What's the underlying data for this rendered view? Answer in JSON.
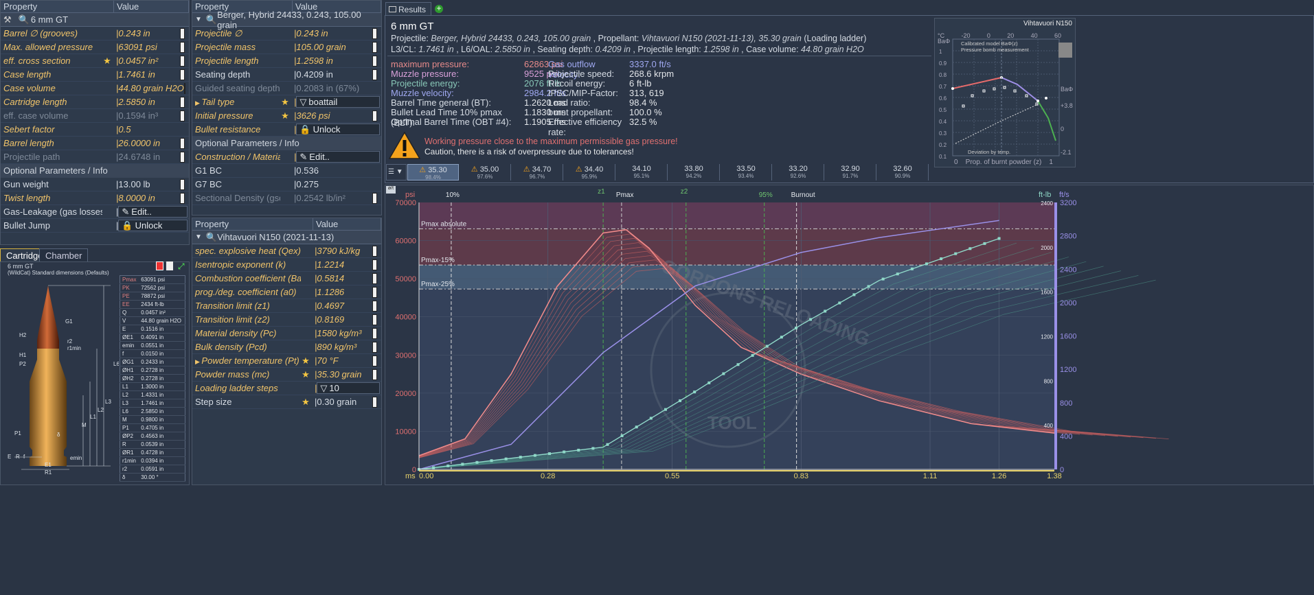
{
  "cartridge_panel": {
    "headers": [
      "Property",
      "Value"
    ],
    "title": "6 mm GT",
    "rows": [
      {
        "k": "Barrel ∅ (grooves)",
        "v": "0.243 in",
        "style": "it",
        "spin": true
      },
      {
        "k": "Max. allowed pressure",
        "v": "63091 psi",
        "style": "it",
        "spin": true
      },
      {
        "k": "eff. cross section",
        "v": "0.0457 in²",
        "style": "it",
        "star": true,
        "spin": true
      },
      {
        "k": "Case length",
        "v": "1.7461 in",
        "style": "it",
        "spin": true
      },
      {
        "k": "Case volume",
        "v": "44.80 grain H2O",
        "style": "it",
        "spin": true
      },
      {
        "k": "Cartridge length",
        "v": "2.5850 in",
        "style": "it",
        "spin": true
      },
      {
        "k": "eff. case volume",
        "v": "0.1594 in³",
        "style": "dim",
        "spin": true
      },
      {
        "k": "Sebert factor",
        "v": "0.5",
        "style": "it"
      },
      {
        "k": "Barrel length",
        "v": "26.0000 in",
        "style": "it",
        "spin": true
      },
      {
        "k": "Projectile path",
        "v": "24.6748 in",
        "style": "dim",
        "spin": true
      }
    ],
    "optional_title": "Optional Parameters / Info",
    "optional_rows": [
      {
        "k": "Gun weight",
        "v": "13.00 lb",
        "style": "",
        "spin": true
      },
      {
        "k": "Twist length",
        "v": "8.0000 in",
        "style": "it",
        "spin": true
      },
      {
        "k": "Gas-Leakage (gas losses)",
        "v": "Edit..",
        "style": "",
        "button": true
      },
      {
        "k": "Bullet Jump",
        "v": "Unlock",
        "style": "",
        "button": true
      }
    ]
  },
  "projectile_panel": {
    "headers": [
      "Property",
      "Value"
    ],
    "title": "Berger, Hybrid 24433, 0.243, 105.00 grain",
    "rows": [
      {
        "k": "Projectile ∅",
        "v": "0.243 in",
        "style": "it",
        "spin": true
      },
      {
        "k": "Projectile mass",
        "v": "105.00 grain",
        "style": "it",
        "spin": true
      },
      {
        "k": "Projectile length",
        "v": "1.2598 in",
        "style": "it",
        "spin": true
      },
      {
        "k": "Seating depth",
        "v": "0.4209 in",
        "style": "",
        "spin": true
      },
      {
        "k": "Guided seating depth",
        "v": "0.2083 in (67%)",
        "style": "dim"
      },
      {
        "k": "Tail type",
        "v": "boattail",
        "style": "it",
        "star": true,
        "button": true,
        "expand": true
      },
      {
        "k": "Initial pressure",
        "v": "3626 psi",
        "style": "it",
        "star": true,
        "spin": true
      },
      {
        "k": "Bullet resistance",
        "v": "Unlock",
        "style": "it",
        "button": true
      }
    ],
    "optional_title": "Optional Parameters / Info",
    "optional_rows": [
      {
        "k": "Construction / Material",
        "v": "Edit..",
        "style": "it",
        "button": true
      },
      {
        "k": "G1 BC",
        "v": "0.536",
        "style": ""
      },
      {
        "k": "G7 BC",
        "v": "0.275",
        "style": ""
      },
      {
        "k": "Sectional Density (gsd)",
        "v": "0.2542 lb/in²",
        "style": "dim",
        "spin": true
      }
    ]
  },
  "powder_panel": {
    "headers": [
      "Property",
      "Value"
    ],
    "title": "Vihtavuori N150 (2021-11-13)",
    "rows": [
      {
        "k": "spec. explosive heat (Qex)",
        "v": "3790 kJ/kg",
        "style": "it",
        "spin": true
      },
      {
        "k": "Isentropic exponent (k)",
        "v": "1.2214",
        "style": "it",
        "spin": true
      },
      {
        "k": "Combustion coefficient (Ba)",
        "v": "0.5814",
        "style": "it",
        "spin": true
      },
      {
        "k": "prog./deg. coefficient (a0)",
        "v": "1.1286",
        "style": "it",
        "spin": true
      },
      {
        "k": "Transition limit (z1)",
        "v": "0.4697",
        "style": "it",
        "spin": true
      },
      {
        "k": "Transition limit (z2)",
        "v": "0.8169",
        "style": "it",
        "spin": true
      },
      {
        "k": "Material density (Pc)",
        "v": "1580 kg/m³",
        "style": "it",
        "spin": true
      },
      {
        "k": "Bulk density (Pcd)",
        "v": "890 kg/m³",
        "style": "it",
        "spin": true
      },
      {
        "k": "Powder temperature (Pt)",
        "v": "70 °F",
        "style": "it",
        "star": true,
        "spin": true,
        "expand": true
      },
      {
        "k": "Powder mass (mc)",
        "v": "35.30 grain",
        "style": "it",
        "star": true,
        "spin": true
      },
      {
        "k": "Loading ladder steps",
        "v": "10",
        "style": "it",
        "button": true
      },
      {
        "k": "Step size",
        "v": "0.30 grain",
        "style": "",
        "star": true,
        "spin": true
      }
    ]
  },
  "lower_tabs": [
    "Cartridge",
    "Chamber"
  ],
  "drawing": {
    "title": "6 mm GT",
    "subtitle": "(WildCat) Standard dimensions (Defaults)",
    "labels": [
      "G1",
      "H2",
      "r2",
      "r1min",
      "H1",
      "P2",
      "L6",
      "L3",
      "L2",
      "L1",
      "M",
      "P1",
      "δ",
      "E",
      "R",
      "f",
      "E1",
      "R1",
      "emin"
    ],
    "specs": [
      [
        "Pmax",
        "63091 psi"
      ],
      [
        "PK",
        "72562 psi"
      ],
      [
        "PE",
        "78872 psi"
      ],
      [
        "EE",
        "2434 ft-lb"
      ],
      [
        "Q",
        "0.0457 in²"
      ],
      [
        "V",
        "44.80 grain H2O"
      ],
      [
        "E",
        "0.1516 in"
      ],
      [
        "ØE1",
        "0.4091 in"
      ],
      [
        "emin",
        "0.0551 in"
      ],
      [
        "f",
        "0.0150 in"
      ],
      [
        "ØG1",
        "0.2433 in"
      ],
      [
        "ØH1",
        "0.2728 in"
      ],
      [
        "ØH2",
        "0.2728 in"
      ],
      [
        "L1",
        "1.3000 in"
      ],
      [
        "L2",
        "1.4331 in"
      ],
      [
        "L3",
        "1.7461 in"
      ],
      [
        "L6",
        "2.5850 in"
      ],
      [
        "M",
        "0.9800 in"
      ],
      [
        "P1",
        "0.4705 in"
      ],
      [
        "ØP2",
        "0.4563 in"
      ],
      [
        "R",
        "0.0539 in"
      ],
      [
        "ØR1",
        "0.4728 in"
      ],
      [
        "r1min",
        "0.0394 in"
      ],
      [
        "r2",
        "0.0591 in"
      ],
      [
        "δ",
        "30.00 °"
      ]
    ]
  },
  "results": {
    "tab_label": "Results",
    "title": "6 mm GT",
    "line1_parts": [
      "Projectile:",
      "Berger, Hybrid 24433, 0.243, 105.00 grain",
      ", Propellant:",
      "Vihtavuori N150 (2021-11-13), 35.30 grain",
      "(Loading ladder)"
    ],
    "line2_parts": [
      "L3/CL:",
      "1.7461 in",
      ", L6/OAL:",
      "2.5850 in",
      ", Seating depth:",
      "0.4209 in",
      ", Projectile length:",
      "1.2598 in",
      ", Case volume:",
      "44.80 grain H2O"
    ],
    "col1": [
      {
        "k": "maximum pressure:",
        "v": "62863 psi",
        "c": "lbl"
      },
      {
        "k": "Muzzle pressure:",
        "v": "9525 psi",
        "c": "lbl2"
      },
      {
        "k": "Projectile energy:",
        "v": "2076 ft-lb",
        "c": "lbl4"
      },
      {
        "k": "Muzzle velocity:",
        "v": "2984.2 ft/s",
        "c": "lbl3"
      },
      {
        "k": "Barrel Time general (BT):",
        "v": "1.2620 ms",
        "c": ""
      },
      {
        "k": "Bullet Lead Time 10% pmax (BLT):",
        "v": "1.1830 ms",
        "c": ""
      },
      {
        "k": "Optimal Barrel Time (OBT #4):",
        "v": "1.1905 ms",
        "c": ""
      }
    ],
    "col2": [
      {
        "k": "Gas outflow velocity:",
        "v": "3337.0 ft/s",
        "c": "lbl3"
      },
      {
        "k": "Projectile speed:",
        "v": "268.6 krpm",
        "c": ""
      },
      {
        "k": "Recoil energy:",
        "v": "6 ft-lb",
        "c": ""
      },
      {
        "k": "IPSC/MIP-Factor:",
        "v": "313, 619",
        "c": ""
      },
      {
        "k": "Load ratio:",
        "v": "98.4 %",
        "c": ""
      },
      {
        "k": "burnt propellant:",
        "v": "100.0 %",
        "c": ""
      },
      {
        "k": "Effective efficiency rate:",
        "v": "32.5 %",
        "c": ""
      }
    ],
    "warning1": "Working pressure close to the maximum permissible gas pressure!",
    "warning2": "Caution, there is a risk of overpressure due to tolerances!",
    "ladder": [
      {
        "a": "35.30",
        "b": "98.4%",
        "warn": true
      },
      {
        "a": "35.00",
        "b": "97.6%",
        "warn": true
      },
      {
        "a": "34.70",
        "b": "96.7%",
        "warn": true
      },
      {
        "a": "34.40",
        "b": "95.9%",
        "warn": true
      },
      {
        "a": "34.10",
        "b": "95.1%",
        "warn": false
      },
      {
        "a": "33.80",
        "b": "94.2%",
        "warn": false
      },
      {
        "a": "33.50",
        "b": "93.4%",
        "warn": false
      },
      {
        "a": "33.20",
        "b": "92.6%",
        "warn": false
      },
      {
        "a": "32.90",
        "b": "91.7%",
        "warn": false
      },
      {
        "a": "32.60",
        "b": "90.9%",
        "warn": false
      }
    ]
  },
  "mini_chart": {
    "title": "Vihtavuori N150",
    "legend": [
      "Calibrated model BaΦ(z)",
      "Pressure bomb measurement",
      "Deviation by temp."
    ],
    "left_label": "BaΦ",
    "right_label": "BaΦ",
    "top_ticks": [
      "°C",
      "-20",
      "0",
      "20",
      "40",
      "60"
    ],
    "y_ticks": [
      "1",
      "0.9",
      "0.8",
      "0.7",
      "0.6",
      "0.5",
      "0.4",
      "0.3",
      "0.2",
      "0.1"
    ],
    "right_ticks": [
      "+3.8",
      "0",
      "-2.1"
    ],
    "x_label": "0    Prop. of burnt powder (z)    1"
  },
  "main_chart": {
    "left_unit": "psi",
    "right_unit1": "ft-lb",
    "right_unit2": "ft/s",
    "y_ticks": [
      "70000",
      "60000",
      "50000",
      "40000",
      "30000",
      "20000",
      "10000",
      "0"
    ],
    "energy_ticks": [
      "2400",
      "2000",
      "1600",
      "1200",
      "800",
      "400"
    ],
    "velocity_ticks": [
      "3200",
      "2800",
      "2400",
      "2000",
      "1600",
      "1200",
      "800",
      "400",
      "0"
    ],
    "x_unit": "ms",
    "x_ticks": [
      "0.00",
      "0.28",
      "0.55",
      "0.83",
      "1.11",
      "1.26",
      "1.38"
    ],
    "markers": [
      "10%",
      "z1",
      "Pmax",
      "z2",
      "95%",
      "Burnout"
    ],
    "bands": [
      "Pmax absolute",
      "Pmax-15%",
      "Pmax-25%"
    ],
    "watermark_top": "GORDONS RELOADING",
    "watermark_bottom": "TOOL"
  },
  "chart_data": {
    "type": "line",
    "xlabel": "ms",
    "ylabel": "psi",
    "xlim": [
      0,
      1.38
    ],
    "ylim": [
      0,
      70000
    ],
    "series": [
      {
        "name": "pressure",
        "x": [
          0,
          0.1,
          0.2,
          0.3,
          0.4,
          0.45,
          0.5,
          0.6,
          0.7,
          0.83,
          1.0,
          1.2,
          1.38
        ],
        "values": [
          3600,
          8000,
          25000,
          48000,
          62000,
          62863,
          58000,
          43000,
          32000,
          25000,
          18000,
          12000,
          9525
        ]
      },
      {
        "x": [
          0,
          0.2,
          0.4,
          0.6,
          0.83,
          1.0,
          1.26
        ],
        "values": [
          0,
          300,
          1400,
          2200,
          2600,
          2780,
          2984
        ]
      },
      {
        "x": [
          0,
          0.4,
          0.6,
          0.83,
          1.0,
          1.26
        ],
        "values": [
          0,
          200,
          700,
          1300,
          1700,
          2076
        ]
      }
    ]
  }
}
